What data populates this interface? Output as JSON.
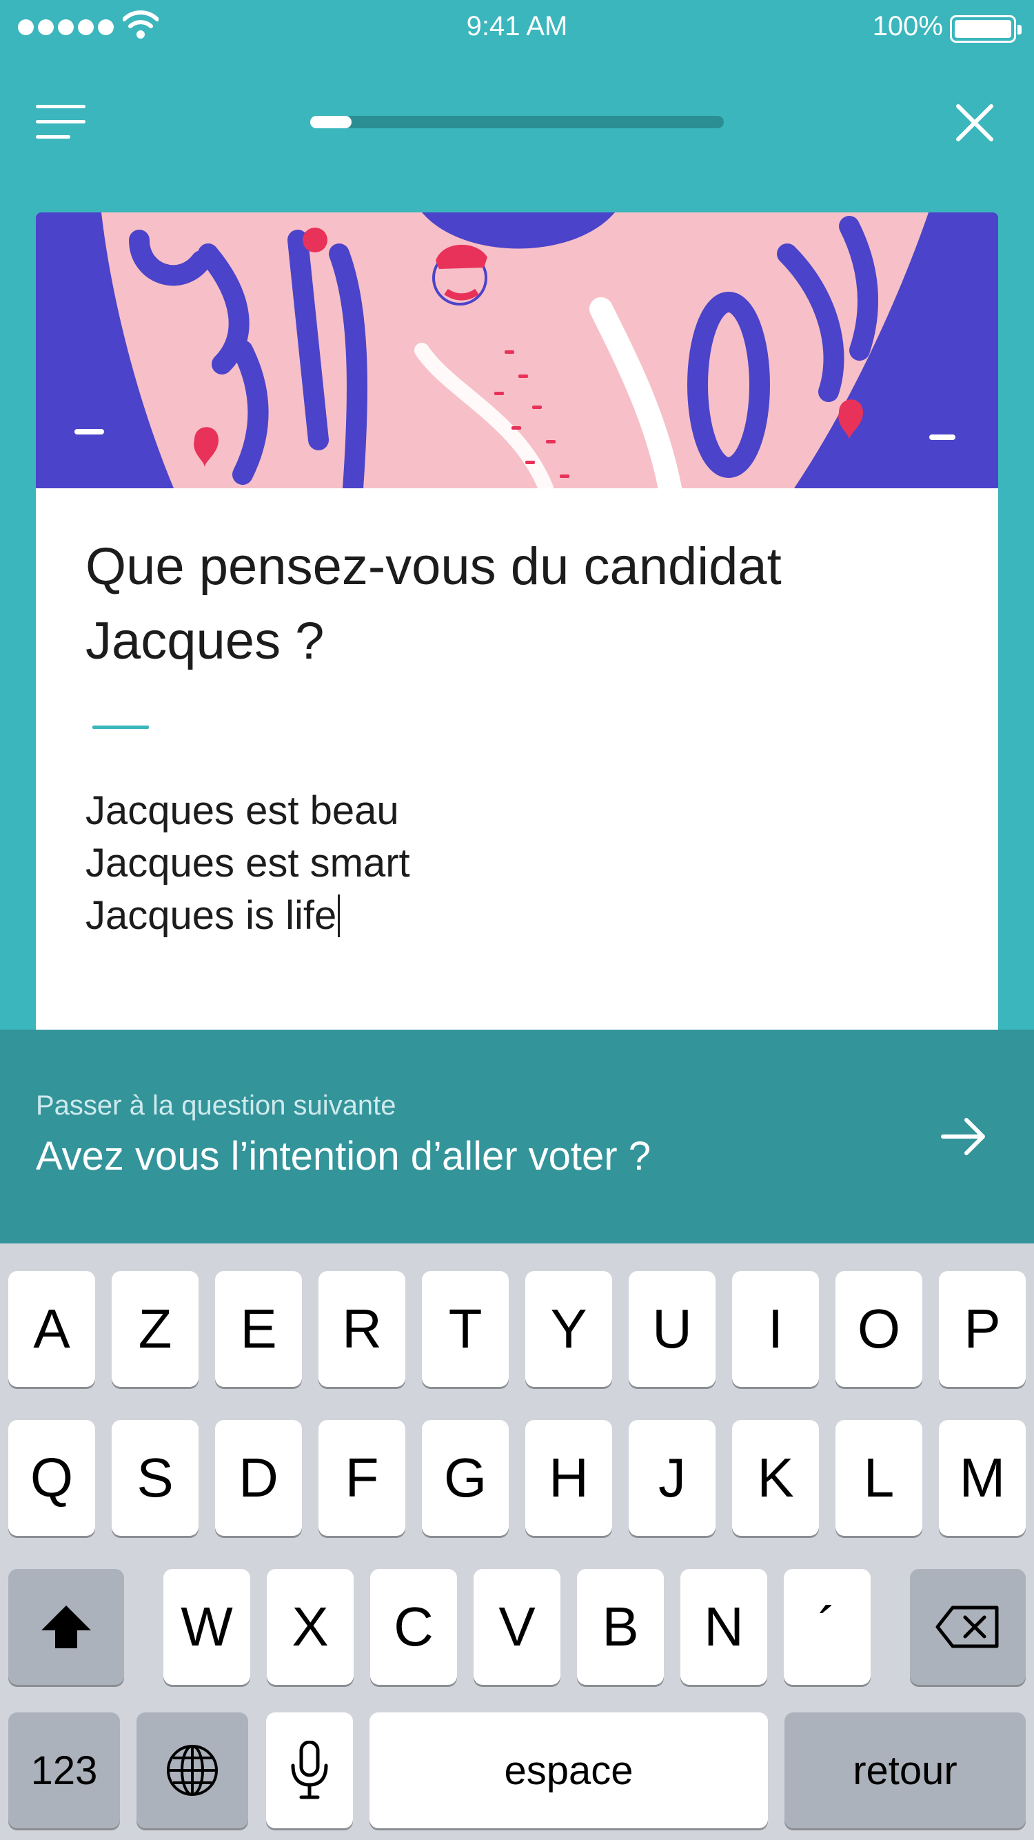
{
  "status_bar": {
    "time": "9:41 AM",
    "battery": "100%",
    "signal_icon": "signal-dots-icon",
    "wifi_icon": "wifi-icon",
    "battery_icon": "battery-icon"
  },
  "nav": {
    "menu_icon": "menu-icon",
    "close_icon": "close-icon",
    "progress": 0.1
  },
  "card": {
    "title": "Que pensez-vous du candidat Jacques ?",
    "answer_lines": [
      "Jacques est beau",
      "Jacques est smart",
      "Jacques is life"
    ]
  },
  "next": {
    "hint": "Passer à la question suivante",
    "question": "Avez vous l’intention d’aller voter ?",
    "icon": "arrow-right-icon"
  },
  "keyboard": {
    "row1": [
      "A",
      "Z",
      "E",
      "R",
      "T",
      "Y",
      "U",
      "I",
      "O",
      "P"
    ],
    "row2": [
      "Q",
      "S",
      "D",
      "F",
      "G",
      "H",
      "J",
      "K",
      "L",
      "M"
    ],
    "row3": [
      "W",
      "X",
      "C",
      "V",
      "B",
      "N",
      "´"
    ],
    "numbers": "123",
    "space": "espace",
    "return": "retour",
    "shift_icon": "shift-icon",
    "delete_icon": "delete-icon",
    "globe_icon": "globe-icon",
    "mic_icon": "microphone-icon"
  },
  "colors": {
    "teal": "#3bb6bd",
    "banner": "#33949a",
    "hero_blue": "#4b43c9",
    "hero_pink": "#f7c0c8",
    "accent_red": "#e8325a"
  }
}
